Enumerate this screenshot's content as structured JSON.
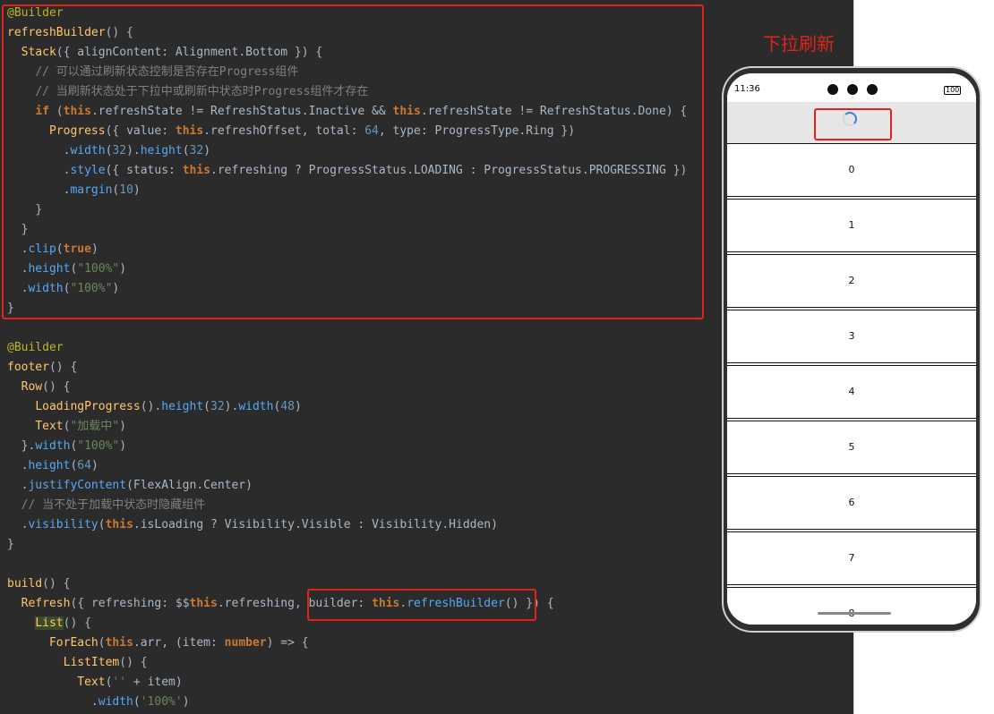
{
  "code": {
    "lines": [
      [
        [
          "tok-ann",
          "@Builder"
        ]
      ],
      [
        [
          "tok-fn",
          "refreshBuilder"
        ],
        [
          "tok-punc",
          "() {"
        ]
      ],
      [
        [
          "tok-plain",
          "  "
        ],
        [
          "tok-fn",
          "Stack"
        ],
        [
          "tok-punc",
          "({ "
        ],
        [
          "tok-prop",
          "alignContent"
        ],
        [
          "tok-punc",
          ": "
        ],
        [
          "tok-type",
          "Alignment"
        ],
        [
          "tok-punc",
          "."
        ],
        [
          "tok-prop",
          "Bottom"
        ],
        [
          "tok-punc",
          " }) {"
        ]
      ],
      [
        [
          "tok-plain",
          "    "
        ],
        [
          "tok-comment",
          "// 可以通过刷新状态控制是否存在Progress组件"
        ]
      ],
      [
        [
          "tok-plain",
          "    "
        ],
        [
          "tok-comment",
          "// 当刷新状态处于下拉中或刷新中状态时Progress组件才存在"
        ]
      ],
      [
        [
          "tok-plain",
          "    "
        ],
        [
          "tok-kw",
          "if"
        ],
        [
          "tok-punc",
          " ("
        ],
        [
          "tok-kw",
          "this"
        ],
        [
          "tok-punc",
          "."
        ],
        [
          "tok-prop",
          "refreshState"
        ],
        [
          "tok-op",
          " != "
        ],
        [
          "tok-type",
          "RefreshStatus"
        ],
        [
          "tok-punc",
          "."
        ],
        [
          "tok-prop",
          "Inactive"
        ],
        [
          "tok-op",
          " && "
        ],
        [
          "tok-kw",
          "this"
        ],
        [
          "tok-punc",
          "."
        ],
        [
          "tok-prop",
          "refreshState"
        ],
        [
          "tok-op",
          " != "
        ],
        [
          "tok-type",
          "RefreshStatus"
        ],
        [
          "tok-punc",
          "."
        ],
        [
          "tok-prop",
          "Done"
        ],
        [
          "tok-punc",
          ") {"
        ]
      ],
      [
        [
          "tok-plain",
          "      "
        ],
        [
          "tok-fn",
          "Progress"
        ],
        [
          "tok-punc",
          "({ "
        ],
        [
          "tok-prop",
          "value"
        ],
        [
          "tok-punc",
          ": "
        ],
        [
          "tok-kw",
          "this"
        ],
        [
          "tok-punc",
          "."
        ],
        [
          "tok-prop",
          "refreshOffset"
        ],
        [
          "tok-punc",
          ", "
        ],
        [
          "tok-prop",
          "total"
        ],
        [
          "tok-punc",
          ": "
        ],
        [
          "tok-num",
          "64"
        ],
        [
          "tok-punc",
          ", "
        ],
        [
          "tok-prop",
          "type"
        ],
        [
          "tok-punc",
          ": "
        ],
        [
          "tok-type",
          "ProgressType"
        ],
        [
          "tok-punc",
          "."
        ],
        [
          "tok-prop",
          "Ring"
        ],
        [
          "tok-punc",
          " })"
        ]
      ],
      [
        [
          "tok-plain",
          "        "
        ],
        [
          "tok-punc",
          "."
        ],
        [
          "tok-method",
          "width"
        ],
        [
          "tok-punc",
          "("
        ],
        [
          "tok-num",
          "32"
        ],
        [
          "tok-punc",
          ")."
        ],
        [
          "tok-method",
          "height"
        ],
        [
          "tok-punc",
          "("
        ],
        [
          "tok-num",
          "32"
        ],
        [
          "tok-punc",
          ")"
        ]
      ],
      [
        [
          "tok-plain",
          "        "
        ],
        [
          "tok-punc",
          "."
        ],
        [
          "tok-method",
          "style"
        ],
        [
          "tok-punc",
          "({ "
        ],
        [
          "tok-prop",
          "status"
        ],
        [
          "tok-punc",
          ": "
        ],
        [
          "tok-kw",
          "this"
        ],
        [
          "tok-punc",
          "."
        ],
        [
          "tok-prop",
          "refreshing"
        ],
        [
          "tok-op",
          " ? "
        ],
        [
          "tok-type",
          "ProgressStatus"
        ],
        [
          "tok-punc",
          "."
        ],
        [
          "tok-prop",
          "LOADING"
        ],
        [
          "tok-op",
          " : "
        ],
        [
          "tok-type",
          "ProgressStatus"
        ],
        [
          "tok-punc",
          "."
        ],
        [
          "tok-prop",
          "PROGRESSING"
        ],
        [
          "tok-punc",
          " })"
        ]
      ],
      [
        [
          "tok-plain",
          "        "
        ],
        [
          "tok-punc",
          "."
        ],
        [
          "tok-method",
          "margin"
        ],
        [
          "tok-punc",
          "("
        ],
        [
          "tok-num",
          "10"
        ],
        [
          "tok-punc",
          ")"
        ]
      ],
      [
        [
          "tok-plain",
          "    "
        ],
        [
          "tok-punc",
          "}"
        ]
      ],
      [
        [
          "tok-plain",
          "  "
        ],
        [
          "tok-punc",
          "}"
        ]
      ],
      [
        [
          "tok-plain",
          "  "
        ],
        [
          "tok-punc",
          "."
        ],
        [
          "tok-method",
          "clip"
        ],
        [
          "tok-punc",
          "("
        ],
        [
          "tok-kw",
          "true"
        ],
        [
          "tok-punc",
          ")"
        ]
      ],
      [
        [
          "tok-plain",
          "  "
        ],
        [
          "tok-punc",
          "."
        ],
        [
          "tok-method",
          "height"
        ],
        [
          "tok-punc",
          "("
        ],
        [
          "tok-str",
          "\"100%\""
        ],
        [
          "tok-punc",
          ")"
        ]
      ],
      [
        [
          "tok-plain",
          "  "
        ],
        [
          "tok-punc",
          "."
        ],
        [
          "tok-method",
          "width"
        ],
        [
          "tok-punc",
          "("
        ],
        [
          "tok-str",
          "\"100%\""
        ],
        [
          "tok-punc",
          ")"
        ]
      ],
      [
        [
          "tok-punc",
          "}"
        ]
      ],
      [
        [
          "tok-plain",
          ""
        ]
      ],
      [
        [
          "tok-ann",
          "@Builder"
        ]
      ],
      [
        [
          "tok-fn",
          "footer"
        ],
        [
          "tok-punc",
          "() {"
        ]
      ],
      [
        [
          "tok-plain",
          "  "
        ],
        [
          "tok-fn",
          "Row"
        ],
        [
          "tok-punc",
          "() {"
        ]
      ],
      [
        [
          "tok-plain",
          "    "
        ],
        [
          "tok-fn",
          "LoadingProgress"
        ],
        [
          "tok-punc",
          "()."
        ],
        [
          "tok-method",
          "height"
        ],
        [
          "tok-punc",
          "("
        ],
        [
          "tok-num",
          "32"
        ],
        [
          "tok-punc",
          ")."
        ],
        [
          "tok-method",
          "width"
        ],
        [
          "tok-punc",
          "("
        ],
        [
          "tok-num",
          "48"
        ],
        [
          "tok-punc",
          ")"
        ]
      ],
      [
        [
          "tok-plain",
          "    "
        ],
        [
          "tok-fn",
          "Text"
        ],
        [
          "tok-punc",
          "("
        ],
        [
          "tok-str",
          "\"加载中\""
        ],
        [
          "tok-punc",
          ")"
        ]
      ],
      [
        [
          "tok-plain",
          "  "
        ],
        [
          "tok-punc",
          "}."
        ],
        [
          "tok-method",
          "width"
        ],
        [
          "tok-punc",
          "("
        ],
        [
          "tok-str",
          "\"100%\""
        ],
        [
          "tok-punc",
          ")"
        ]
      ],
      [
        [
          "tok-plain",
          "  "
        ],
        [
          "tok-punc",
          "."
        ],
        [
          "tok-method",
          "height"
        ],
        [
          "tok-punc",
          "("
        ],
        [
          "tok-num",
          "64"
        ],
        [
          "tok-punc",
          ")"
        ]
      ],
      [
        [
          "tok-plain",
          "  "
        ],
        [
          "tok-punc",
          "."
        ],
        [
          "tok-method",
          "justifyContent"
        ],
        [
          "tok-punc",
          "("
        ],
        [
          "tok-type",
          "FlexAlign"
        ],
        [
          "tok-punc",
          "."
        ],
        [
          "tok-prop",
          "Center"
        ],
        [
          "tok-punc",
          ")"
        ]
      ],
      [
        [
          "tok-plain",
          "  "
        ],
        [
          "tok-comment",
          "// 当不处于加载中状态时隐藏组件"
        ]
      ],
      [
        [
          "tok-plain",
          "  "
        ],
        [
          "tok-punc",
          "."
        ],
        [
          "tok-method",
          "visibility"
        ],
        [
          "tok-punc",
          "("
        ],
        [
          "tok-kw",
          "this"
        ],
        [
          "tok-punc",
          "."
        ],
        [
          "tok-prop",
          "isLoading"
        ],
        [
          "tok-op",
          " ? "
        ],
        [
          "tok-type",
          "Visibility"
        ],
        [
          "tok-punc",
          "."
        ],
        [
          "tok-prop",
          "Visible"
        ],
        [
          "tok-op",
          " : "
        ],
        [
          "tok-type",
          "Visibility"
        ],
        [
          "tok-punc",
          "."
        ],
        [
          "tok-prop",
          "Hidden"
        ],
        [
          "tok-punc",
          ")"
        ]
      ],
      [
        [
          "tok-punc",
          "}"
        ]
      ],
      [
        [
          "tok-plain",
          ""
        ]
      ],
      [
        [
          "tok-fn",
          "build"
        ],
        [
          "tok-punc",
          "() {"
        ]
      ],
      [
        [
          "tok-plain",
          "  "
        ],
        [
          "tok-fn",
          "Refresh"
        ],
        [
          "tok-punc",
          "({ "
        ],
        [
          "tok-prop",
          "refreshing"
        ],
        [
          "tok-punc",
          ": $$"
        ],
        [
          "tok-kw",
          "this"
        ],
        [
          "tok-punc",
          "."
        ],
        [
          "tok-prop",
          "refreshing"
        ],
        [
          "tok-punc",
          ", "
        ],
        [
          "tok-prop",
          "builder"
        ],
        [
          "tok-punc",
          ": "
        ],
        [
          "tok-kw",
          "this"
        ],
        [
          "tok-punc",
          "."
        ],
        [
          "tok-method",
          "refreshBuilder"
        ],
        [
          "tok-punc",
          "() }) {"
        ]
      ],
      [
        [
          "tok-plain",
          "    "
        ],
        [
          "tok-fn tok-hl",
          "List"
        ],
        [
          "tok-punc",
          "() {"
        ]
      ],
      [
        [
          "tok-plain",
          "      "
        ],
        [
          "tok-fn",
          "ForEach"
        ],
        [
          "tok-punc",
          "("
        ],
        [
          "tok-kw",
          "this"
        ],
        [
          "tok-punc",
          "."
        ],
        [
          "tok-prop",
          "arr"
        ],
        [
          "tok-punc",
          ", ("
        ],
        [
          "tok-prop",
          "item"
        ],
        [
          "tok-punc",
          ": "
        ],
        [
          "tok-kw",
          "number"
        ],
        [
          "tok-punc",
          ") => {"
        ]
      ],
      [
        [
          "tok-plain",
          "        "
        ],
        [
          "tok-fn",
          "ListItem"
        ],
        [
          "tok-punc",
          "() {"
        ]
      ],
      [
        [
          "tok-plain",
          "          "
        ],
        [
          "tok-fn",
          "Text"
        ],
        [
          "tok-punc",
          "("
        ],
        [
          "tok-str",
          "''"
        ],
        [
          "tok-op",
          " + "
        ],
        [
          "tok-prop",
          "item"
        ],
        [
          "tok-punc",
          ")"
        ]
      ],
      [
        [
          "tok-plain",
          "            "
        ],
        [
          "tok-punc",
          "."
        ],
        [
          "tok-method",
          "width"
        ],
        [
          "tok-punc",
          "("
        ],
        [
          "tok-str",
          "'100%'"
        ],
        [
          "tok-punc",
          ")"
        ]
      ]
    ]
  },
  "preview": {
    "caption": "下拉刷新",
    "status_time": "11:36",
    "battery": "100",
    "list_items": [
      "0",
      "1",
      "2",
      "3",
      "4",
      "5",
      "6",
      "7",
      "8"
    ]
  },
  "colors": {
    "highlight_box": "#e0241b",
    "editor_bg": "#2b2b2b",
    "refresh_area_bg": "#e6e6e6",
    "spinner_accent": "#3b7ddd"
  }
}
